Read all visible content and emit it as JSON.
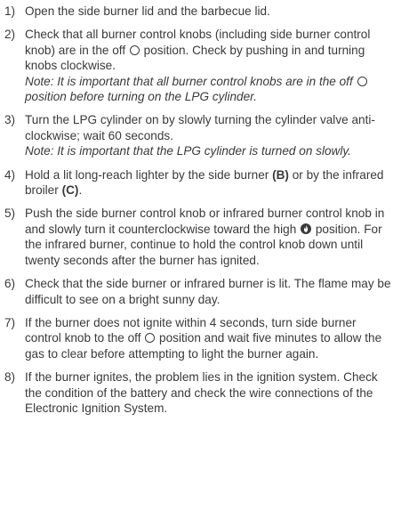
{
  "steps": [
    {
      "num": "1)",
      "parts": {
        "a": "Open the side burner lid and the barbecue lid."
      }
    },
    {
      "num": "2)",
      "parts": {
        "a": "Check that all burner control knobs (including side burner control knob) are in the off ",
        "b": " position. Check by pushing in and turning knobs clockwise.",
        "note_a": "Note: It is important that all burner control knobs are in the off ",
        "note_b": " position before turning on the LPG cylinder."
      }
    },
    {
      "num": "3)",
      "parts": {
        "a": "Turn the LPG cylinder on by slowly turning the cylinder valve anti-clockwise; wait 60 seconds.",
        "note": "Note: It is important that the LPG cylinder is turned on slowly."
      }
    },
    {
      "num": "4)",
      "parts": {
        "a": "Hold a lit long-reach lighter by the side burner ",
        "b_bold": "(B)",
        "c": " or by the infrared broiler ",
        "d_bold": "(C)",
        "e": "."
      }
    },
    {
      "num": "5)",
      "parts": {
        "a": "Push the side burner control knob or infrared burner control knob in and slowly turn it counterclockwise toward the high ",
        "b": " position. For the infrared burner, continue to hold the control knob down until twenty seconds after the burner has ignited."
      }
    },
    {
      "num": "6)",
      "parts": {
        "a": "Check that the side burner or infrared burner is lit. The flame may be difficult to see on a bright sunny day."
      }
    },
    {
      "num": "7)",
      "parts": {
        "a": "If the burner does not ignite within 4 seconds, turn side burner control knob to the off ",
        "b": " position and wait five minutes to allow the gas to clear before attempting to light the burner again."
      }
    },
    {
      "num": "8)",
      "parts": {
        "a": "If the burner ignites, the problem lies in the ignition system. Check the condition of the battery and check the wire connections of the Electronic Ignition System."
      }
    }
  ],
  "icons": {
    "off": "off-circle-icon",
    "high": "flame-high-icon"
  }
}
